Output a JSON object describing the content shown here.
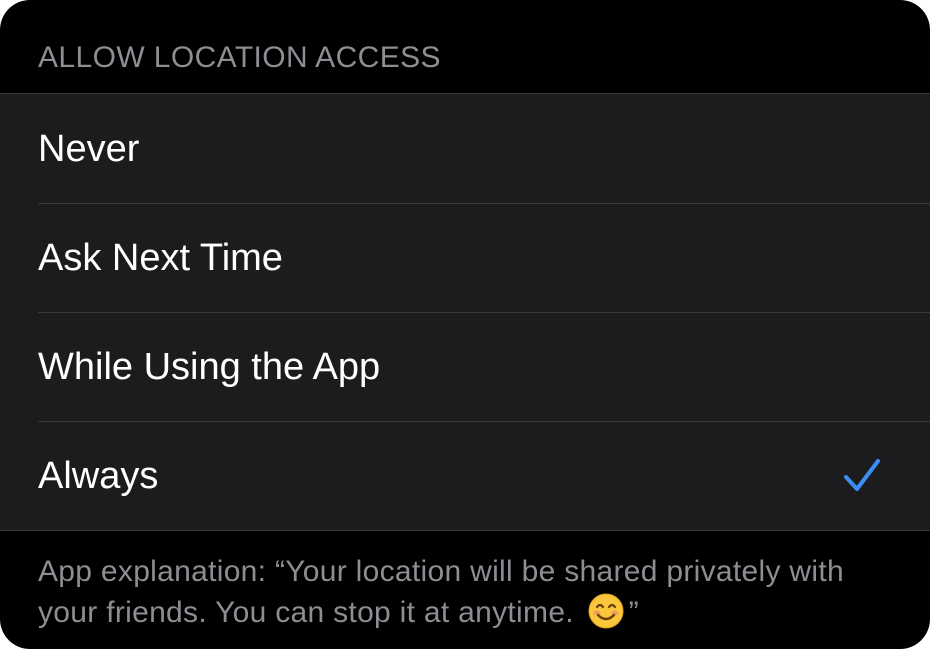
{
  "section": {
    "header": "ALLOW LOCATION ACCESS"
  },
  "options": [
    {
      "label": "Never",
      "selected": false
    },
    {
      "label": "Ask Next Time",
      "selected": false
    },
    {
      "label": "While Using the App",
      "selected": false
    },
    {
      "label": "Always",
      "selected": true
    }
  ],
  "footer": {
    "text_before_emoji": "App explanation: “Your location will be shared privately with your friends. You can stop it at anytime.",
    "emoji_icon": "smiling-face-icon",
    "text_after_emoji": "”"
  },
  "colors": {
    "background": "#000000",
    "group_background": "#1c1c1e",
    "header_text": "#8d8d93",
    "option_text": "#ffffff",
    "checkmark": "#3a8ef6",
    "separator": "#38383a"
  }
}
